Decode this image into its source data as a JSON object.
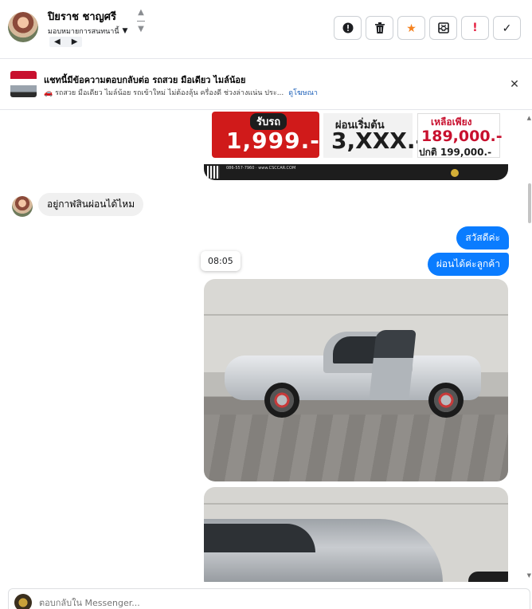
{
  "header": {
    "name": "ปิยราช ชาญศรี",
    "assign_label": "มอบหมายการสนทนานี้",
    "actions": [
      {
        "icon": "alert-circle-icon",
        "glyph": "❗"
      },
      {
        "icon": "trash-icon",
        "glyph": "🗑"
      },
      {
        "icon": "star-icon",
        "glyph": "★"
      },
      {
        "icon": "archive-icon",
        "glyph": "⊠"
      },
      {
        "icon": "exclamation-icon",
        "glyph": "!"
      },
      {
        "icon": "checkmark-icon",
        "glyph": "✓"
      }
    ]
  },
  "ad": {
    "title": "แชทนี้มีข้อความตอบกลับต่อ รถสวย มือเดียว ไมล์น้อย",
    "description": "🚗 รถสวย มือเดียว ไมล์น้อย รถเข้าใหม่ ไม่ต้องลุ้น ครื่องดี ช่วงล่างแน่น ประ...",
    "link": "ดูโฆษณา"
  },
  "promo": {
    "label1": "รับรถ",
    "price1": "1,999.-",
    "label2": "ผ่อนเริ่มต้น",
    "price2": "3,XXX.-",
    "label3": "เหลือเพียง",
    "price3": "189,000.-",
    "normal_price": "ปกติ 199,000.-",
    "footer": "086-557-7960 · www.CSCCAR.COM"
  },
  "messages": {
    "incoming": "อยู่กาฬสินผ่อนได้ไหม",
    "outgoing1": "สวัสดีค่ะ",
    "outgoing2": "ผ่อนได้ค่ะลูกค้า",
    "timestamp": "08:05"
  },
  "composer": {
    "placeholder": "ตอบกลับใน Messenger..."
  },
  "colors": {
    "accent": "#0a7cff",
    "star": "#f5821f",
    "warning": "#e41e3f"
  }
}
